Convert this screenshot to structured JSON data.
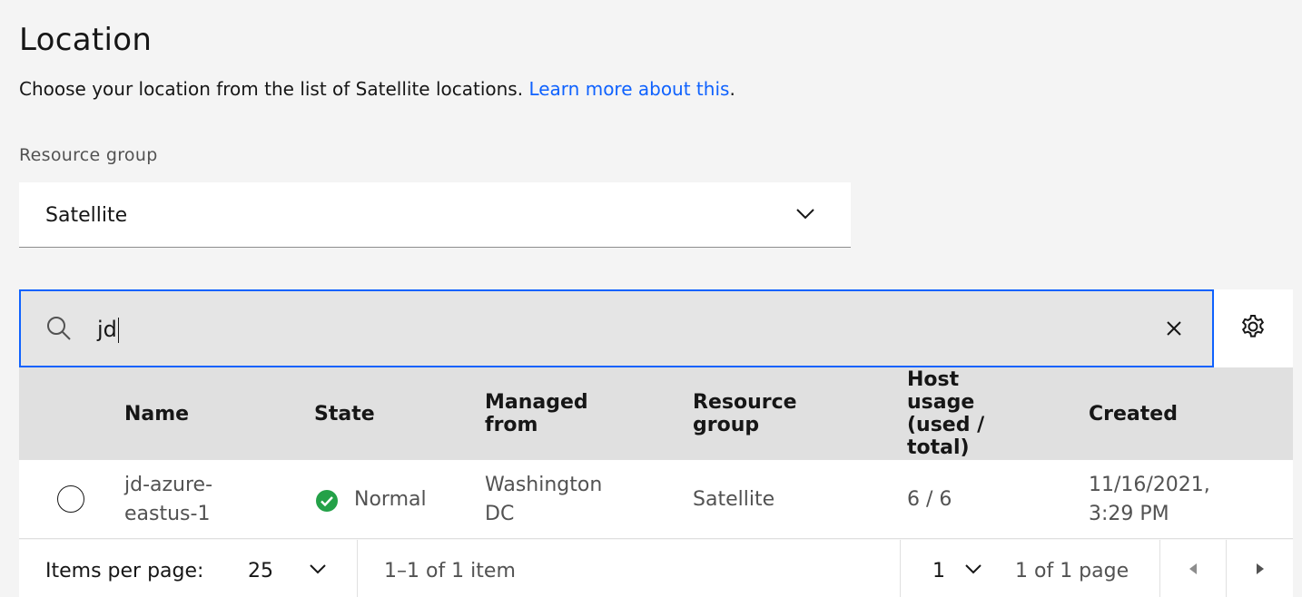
{
  "header": {
    "title": "Location",
    "description": "Choose your location from the list of Satellite locations. ",
    "learn_more_link": "Learn more about this",
    "description_end": "."
  },
  "resource_group": {
    "label": "Resource group",
    "selected": "Satellite"
  },
  "search": {
    "value": "jd"
  },
  "table": {
    "headers": {
      "name": "Name",
      "state": "State",
      "managed_from_1": "Managed",
      "managed_from_2": "from",
      "resource_group_1": "Resource",
      "resource_group_2": "group",
      "host_usage_1": "Host",
      "host_usage_2": "usage",
      "host_usage_3": "(used /",
      "host_usage_4": "total)",
      "created": "Created"
    },
    "rows": [
      {
        "name_1": "jd-azure-",
        "name_2": "eastus-1",
        "state": "Normal",
        "managed_from_1": "Washington",
        "managed_from_2": "DC",
        "resource_group": "Satellite",
        "host_usage": "6 / 6",
        "created_1": "11/16/2021,",
        "created_2": "3:29 PM"
      }
    ]
  },
  "pagination": {
    "items_per_page_label": "Items per page:",
    "items_per_page_value": "25",
    "item_range": "1–1 of 1 item",
    "page_value": "1",
    "page_range": "1 of 1 page"
  },
  "colors": {
    "accent": "#0f62fe",
    "status_normal": "#24a148"
  }
}
